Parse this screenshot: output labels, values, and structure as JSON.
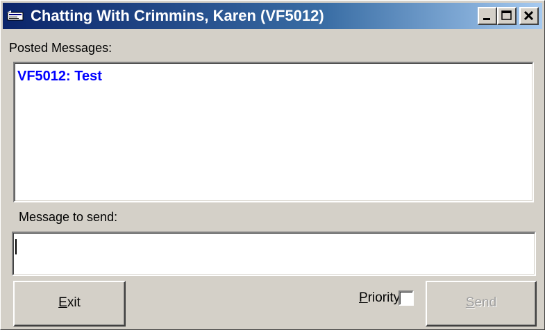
{
  "window": {
    "title": "Chatting With Crimmins, Karen (VF5012)",
    "icon": "chat-window-icon",
    "controls": {
      "minimize": "minimize-icon",
      "maximize": "maximize-icon",
      "close": "close-icon"
    }
  },
  "posted": {
    "label": "Posted Messages:",
    "messages": [
      {
        "text": "VF5012: Test",
        "color": "#0000ff"
      }
    ]
  },
  "compose": {
    "label": "Message to send:",
    "value": ""
  },
  "footer": {
    "exit_label": "Exit",
    "priority_label": "Priority",
    "priority_checked": false,
    "send_label": "Send",
    "send_enabled": false
  },
  "colors": {
    "title_start": "#0a246a",
    "title_end": "#a6caf0",
    "face": "#d4d0c8",
    "message_text": "#0000ff",
    "disabled_text": "#a0a0a0"
  }
}
